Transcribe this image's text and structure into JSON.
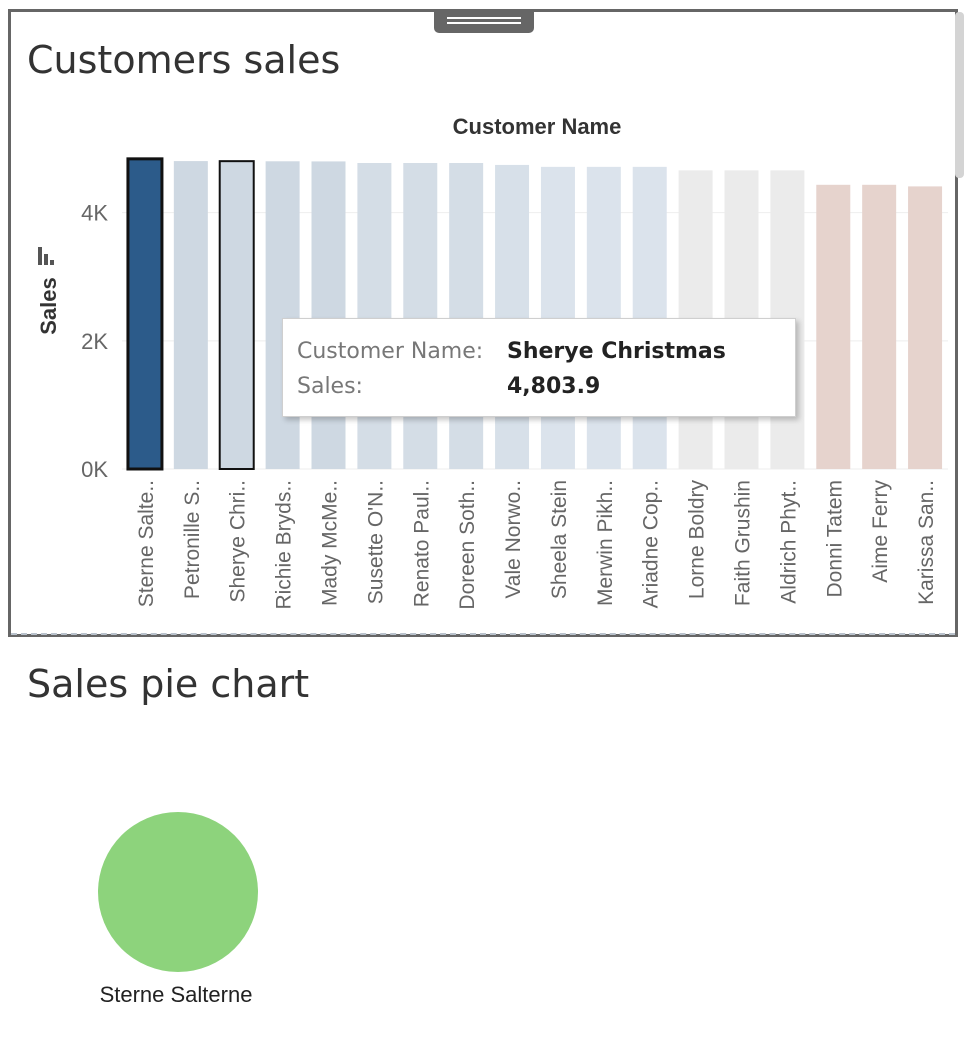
{
  "dashboard": {
    "sheet1_title": "Customers sales",
    "sheet2_title": "Sales pie chart"
  },
  "tooltip": {
    "name_label": "Customer Name:",
    "name_value": "Sherye Christmas",
    "sales_label": "Sales:",
    "sales_value": "4,803.9"
  },
  "chart_data": [
    {
      "type": "bar",
      "title": "",
      "xlabel": "Customer Name",
      "ylabel": "Sales",
      "ylim": [
        0,
        4900
      ],
      "yticks": [
        0,
        2000,
        4000
      ],
      "ytick_labels": [
        "0K",
        "2K",
        "4K"
      ],
      "grid": true,
      "categories": [
        "Sterne Salte..",
        "Petronille S..",
        "Sherye Chri..",
        "Richie Bryds..",
        "Mady McMe..",
        "Susette O'N..",
        "Renato Paul..",
        "Doreen Soth..",
        "Vale Norwo..",
        "Sheela Stein",
        "Merwin Pikh..",
        "Ariadne Cop..",
        "Lorne Boldry",
        "Faith Grushin",
        "Aldrich Phyt..",
        "Donni Tatem",
        "Aime Ferry",
        "Karissa San.."
      ],
      "values": [
        4840,
        4805,
        4803.9,
        4802,
        4800,
        4775,
        4775,
        4775,
        4745,
        4715,
        4715,
        4715,
        4660,
        4660,
        4660,
        4435,
        4435,
        4410
      ],
      "colors": [
        "#2c5b8a",
        "#ced8e2",
        "#ced8e2",
        "#ced8e2",
        "#ced8e2",
        "#d4dde6",
        "#d4dde6",
        "#d4dde6",
        "#d7e0e9",
        "#dbe3ec",
        "#dbe3ec",
        "#dbe3ec",
        "#ebebeb",
        "#ebebeb",
        "#ebebeb",
        "#e6d3cd",
        "#e6d3cd",
        "#e6d3cd"
      ],
      "selected_index": 0,
      "hovered_index": 2,
      "sort_icon": "sort-descending-icon"
    },
    {
      "type": "pie",
      "title": "",
      "slices": [
        {
          "label": "Sterne Salterne",
          "value": 4840,
          "color": "#8dd37c"
        }
      ]
    }
  ]
}
